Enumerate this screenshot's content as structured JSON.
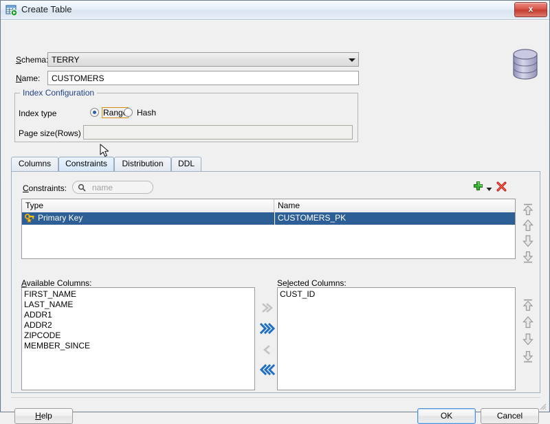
{
  "window": {
    "title": "Create Table",
    "title_icon": "create-table-icon",
    "close_label": "x"
  },
  "form": {
    "schema_label": "Schema:",
    "schema_value": "TERRY",
    "name_label": "Name:",
    "name_value": "CUSTOMERS",
    "db_icon": "database-icon"
  },
  "index_config": {
    "legend": "Index Configuration",
    "index_type_label": "Index type",
    "options": [
      {
        "label": "Range",
        "selected": true,
        "focused": true
      },
      {
        "label": "Hash",
        "selected": false,
        "focused": false
      }
    ],
    "page_size_label": "Page size(Rows)",
    "page_size_value": ""
  },
  "tabs": [
    {
      "label": "Columns",
      "active": false
    },
    {
      "label": "Constraints",
      "active": true
    },
    {
      "label": "Distribution",
      "active": false
    },
    {
      "label": "DDL",
      "active": false
    }
  ],
  "constraints_panel": {
    "search_label": "Constraints:",
    "search_placeholder": "name",
    "search_value": "",
    "add_icon": "green-plus-icon",
    "add_dropdown_icon": "chevron-down-icon",
    "delete_icon": "red-x-delete-icon",
    "table": {
      "columns": [
        "Type",
        "Name"
      ],
      "rows": [
        {
          "type": "Primary Key",
          "name": "CUSTOMERS_PK",
          "icon": "primary-key-icon",
          "selected": true
        }
      ]
    },
    "order_buttons": [
      "move-to-top",
      "move-up",
      "move-down",
      "move-to-bottom"
    ]
  },
  "columns_section": {
    "available_label": "Available Columns:",
    "available_items": [
      "FIRST_NAME",
      "LAST_NAME",
      "ADDR1",
      "ADDR2",
      "ZIPCODE",
      "MEMBER_SINCE"
    ],
    "selected_label": "Selected Columns:",
    "selected_items": [
      "CUST_ID"
    ],
    "transfer_buttons": [
      {
        "name": "add-one",
        "enabled": false
      },
      {
        "name": "add-all",
        "enabled": true
      },
      {
        "name": "remove-one",
        "enabled": false
      },
      {
        "name": "remove-all",
        "enabled": true
      }
    ],
    "order_buttons": [
      "move-to-top",
      "move-up",
      "move-down",
      "move-to-bottom"
    ]
  },
  "footer": {
    "help_label": "Help",
    "ok_label": "OK",
    "cancel_label": "Cancel"
  },
  "colors": {
    "selection_blue": "#2d5f96",
    "group_title_blue": "#21438c",
    "focus_orange": "#d78a16",
    "enabled_arrow_blue": "#1f6fc4",
    "disabled_arrow_gray": "#c2c2c2"
  }
}
